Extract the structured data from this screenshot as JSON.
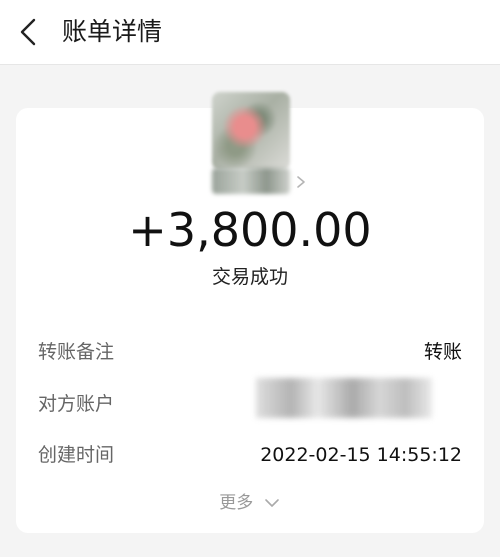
{
  "header": {
    "title": "账单详情",
    "back_icon": "chevron-left-icon"
  },
  "payee": {
    "avatar_icon": "avatar-image",
    "name_icon": "chevron-right-icon"
  },
  "transaction": {
    "amount": "+3,800.00",
    "status": "交易成功"
  },
  "details": [
    {
      "label": "转账备注",
      "value": "转账"
    },
    {
      "label": "对方账户",
      "value": ""
    },
    {
      "label": "创建时间",
      "value": "2022-02-15 14:55:12"
    }
  ],
  "more": {
    "label": "更多",
    "icon": "chevron-down-icon"
  },
  "colors": {
    "background": "#f4f4f4",
    "card": "#ffffff",
    "muted_text": "#666666"
  }
}
